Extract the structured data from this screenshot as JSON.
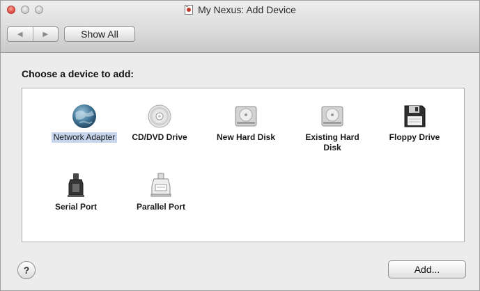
{
  "window": {
    "title": "My Nexus: Add Device"
  },
  "toolbar": {
    "back_glyph": "◀",
    "forward_glyph": "▶",
    "show_all_label": "Show All"
  },
  "dialog": {
    "prompt": "Choose a device to add:",
    "selected_device": "Network Adapter",
    "devices": [
      {
        "label": "Network Adapter",
        "icon": "globe-icon"
      },
      {
        "label": "CD/DVD Drive",
        "icon": "disc-icon"
      },
      {
        "label": "New Hard Disk",
        "icon": "hard-disk-icon"
      },
      {
        "label": "Existing Hard Disk",
        "icon": "hard-disk-icon"
      },
      {
        "label": "Floppy Drive",
        "icon": "floppy-disk-icon"
      },
      {
        "label": "Serial Port",
        "icon": "serial-port-icon"
      },
      {
        "label": "Parallel Port",
        "icon": "parallel-port-icon"
      }
    ]
  },
  "footer": {
    "help_label": "?",
    "add_label": "Add..."
  }
}
